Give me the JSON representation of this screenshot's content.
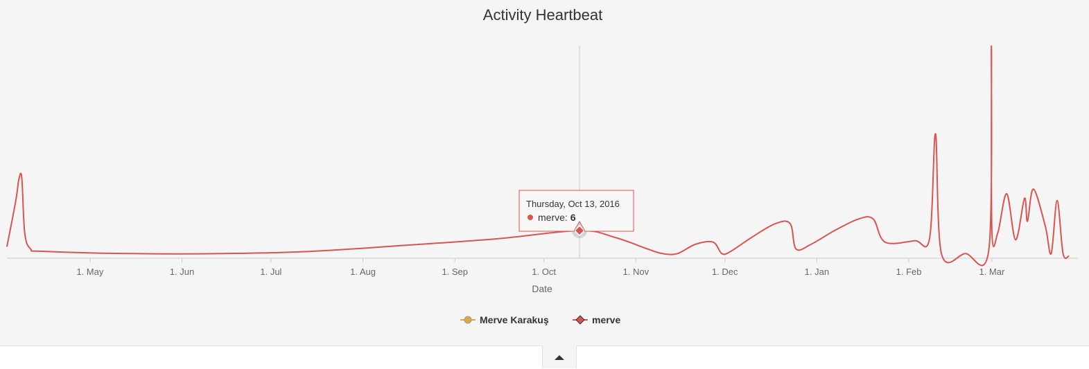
{
  "chart_data": {
    "type": "line",
    "title": "Activity Heartbeat",
    "xlabel": "Date",
    "ylabel": "",
    "x_range": [
      "2016-04-03",
      "2017-03-30"
    ],
    "ylim": [
      0,
      50
    ],
    "grid": false,
    "x_ticks": [
      {
        "date": "2016-05-01",
        "label": "1. May"
      },
      {
        "date": "2016-06-01",
        "label": "1. Jun"
      },
      {
        "date": "2016-07-01",
        "label": "1. Jul"
      },
      {
        "date": "2016-08-01",
        "label": "1. Aug"
      },
      {
        "date": "2016-09-01",
        "label": "1. Sep"
      },
      {
        "date": "2016-10-01",
        "label": "1. Oct"
      },
      {
        "date": "2016-11-01",
        "label": "1. Nov"
      },
      {
        "date": "2016-12-01",
        "label": "1. Dec"
      },
      {
        "date": "2017-01-01",
        "label": "1. Jan"
      },
      {
        "date": "2017-02-01",
        "label": "1. Feb"
      },
      {
        "date": "2017-03-01",
        "label": "1. Mar"
      }
    ],
    "legend": {
      "position": "bottom",
      "items": [
        {
          "name": "Merve Karakuş",
          "color": "#e0a840",
          "marker": "circle"
        },
        {
          "name": "merve",
          "color": "#d9534f",
          "marker": "diamond"
        }
      ]
    },
    "series": [
      {
        "name": "merve",
        "color": "#d9534f",
        "points": [
          [
            "2016-04-03",
            2.5
          ],
          [
            "2016-04-06",
            12.5
          ],
          [
            "2016-04-07",
            17
          ],
          [
            "2016-04-08",
            17.5
          ],
          [
            "2016-04-09",
            5.5
          ],
          [
            "2016-04-11",
            2
          ],
          [
            "2016-04-15",
            1.5
          ],
          [
            "2016-05-15",
            1
          ],
          [
            "2016-06-15",
            1
          ],
          [
            "2016-07-15",
            1.5
          ],
          [
            "2016-08-15",
            2.8
          ],
          [
            "2016-09-15",
            4.2
          ],
          [
            "2016-10-13",
            6
          ],
          [
            "2016-10-25",
            4.5
          ],
          [
            "2016-11-05",
            2
          ],
          [
            "2016-11-10",
            1
          ],
          [
            "2016-11-15",
            1
          ],
          [
            "2016-11-21",
            3
          ],
          [
            "2016-11-27",
            3.5
          ],
          [
            "2016-11-30",
            1
          ],
          [
            "2016-12-03",
            1.5
          ],
          [
            "2016-12-10",
            4.5
          ],
          [
            "2016-12-18",
            7.5
          ],
          [
            "2016-12-23",
            7.5
          ],
          [
            "2016-12-25",
            2
          ],
          [
            "2016-12-30",
            3
          ],
          [
            "2017-01-07",
            6
          ],
          [
            "2017-01-15",
            8.5
          ],
          [
            "2017-01-20",
            8.5
          ],
          [
            "2017-01-24",
            3.5
          ],
          [
            "2017-02-03",
            3.8
          ],
          [
            "2017-02-08",
            4.3
          ],
          [
            "2017-02-10",
            27
          ],
          [
            "2017-02-12",
            1
          ],
          [
            "2017-02-20",
            1
          ],
          [
            "2017-02-28",
            2
          ],
          [
            "2017-02-28T20:00",
            46
          ],
          [
            "2017-03-01",
            6
          ],
          [
            "2017-03-03",
            5.5
          ],
          [
            "2017-03-06",
            14
          ],
          [
            "2017-03-09",
            4
          ],
          [
            "2017-03-12",
            13
          ],
          [
            "2017-03-13",
            8
          ],
          [
            "2017-03-15",
            15
          ],
          [
            "2017-03-19",
            7
          ],
          [
            "2017-03-21",
            1
          ],
          [
            "2017-03-23",
            12.5
          ],
          [
            "2017-03-25",
            1
          ],
          [
            "2017-03-27",
            0.5
          ]
        ]
      }
    ],
    "hover": {
      "date": "2016-10-13",
      "date_label": "Thursday, Oct 13, 2016",
      "series": "merve",
      "value": 6,
      "value_label": "6"
    }
  }
}
